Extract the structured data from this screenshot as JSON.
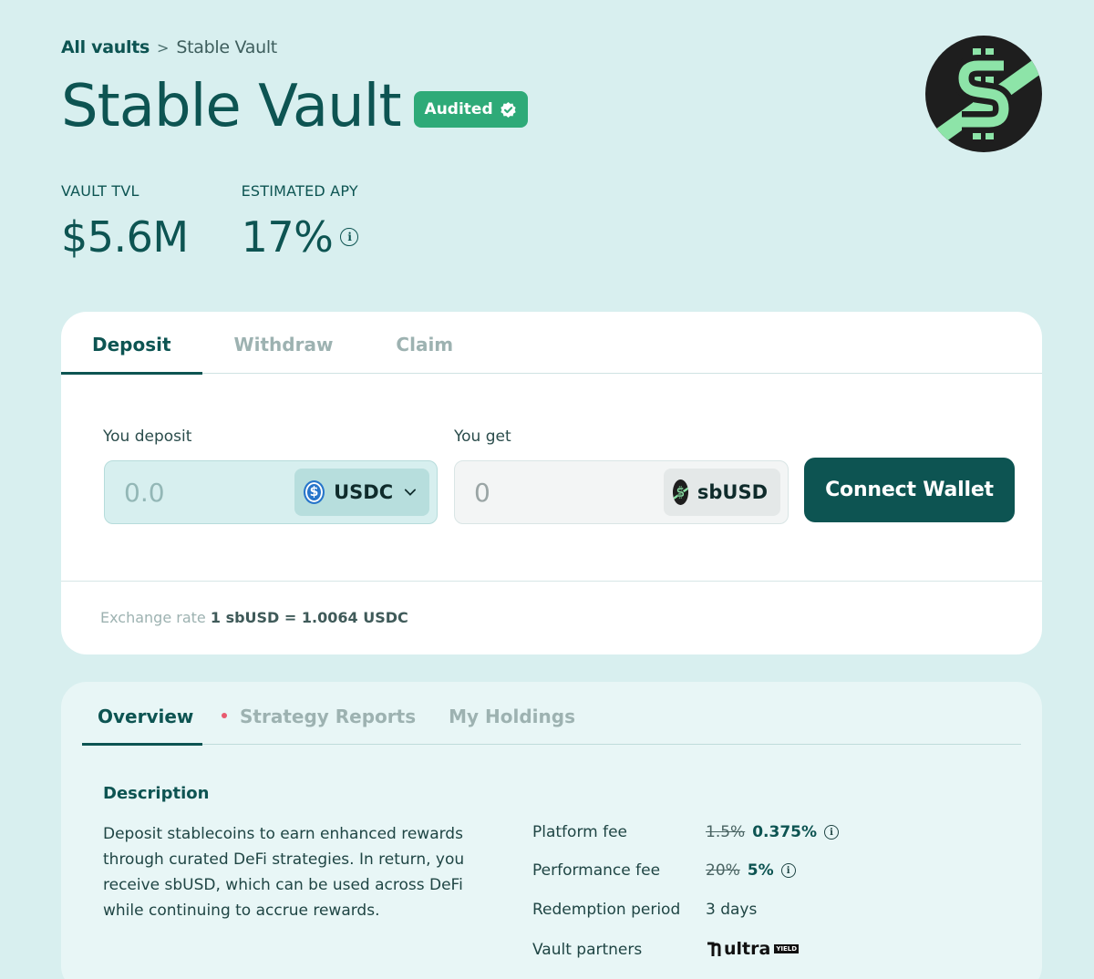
{
  "breadcrumb": {
    "root": "All vaults",
    "separator": ">",
    "current": "Stable Vault"
  },
  "header": {
    "title": "Stable Vault",
    "badge": "Audited"
  },
  "stats": {
    "tvl_label": "VAULT TVL",
    "tvl_value": "$5.6M",
    "apy_label": "ESTIMATED APY",
    "apy_value": "17%"
  },
  "action_card": {
    "tabs": [
      {
        "label": "Deposit"
      },
      {
        "label": "Withdraw"
      },
      {
        "label": "Claim"
      }
    ],
    "deposit_label": "You deposit",
    "deposit_placeholder": "0.0",
    "deposit_token": "USDC",
    "get_label": "You get",
    "get_value": "0",
    "get_token": "sbUSD",
    "connect_button": "Connect Wallet",
    "rate_label": "Exchange rate",
    "rate_value": "1 sbUSD = 1.0064 USDC"
  },
  "info_card": {
    "tabs": [
      {
        "label": "Overview"
      },
      {
        "label": "Strategy Reports"
      },
      {
        "label": "My Holdings"
      }
    ],
    "description_heading": "Description",
    "description": "Deposit stablecoins to earn enhanced rewards through curated DeFi strategies. In return, you receive sbUSD, which can be used across DeFi while continuing to accrue rewards.",
    "details": {
      "platform_fee_label": "Platform fee",
      "platform_fee_old": "1.5%",
      "platform_fee_new": "0.375%",
      "performance_fee_label": "Performance fee",
      "performance_fee_old": "20%",
      "performance_fee_new": "5%",
      "redemption_label": "Redemption period",
      "redemption_value": "3 days",
      "partners_label": "Vault partners",
      "partner_name": "ultra",
      "partner_tag": "YIELD"
    }
  },
  "colors": {
    "primary": "#0d5452",
    "accent_green": "#2eaa78",
    "background": "#d8efef",
    "dot": "#e85a6f"
  },
  "icons": [
    "verified-check-icon",
    "info-icon",
    "usdc-icon",
    "sbusd-icon",
    "chevron-down-icon",
    "ultra-logo-icon"
  ]
}
